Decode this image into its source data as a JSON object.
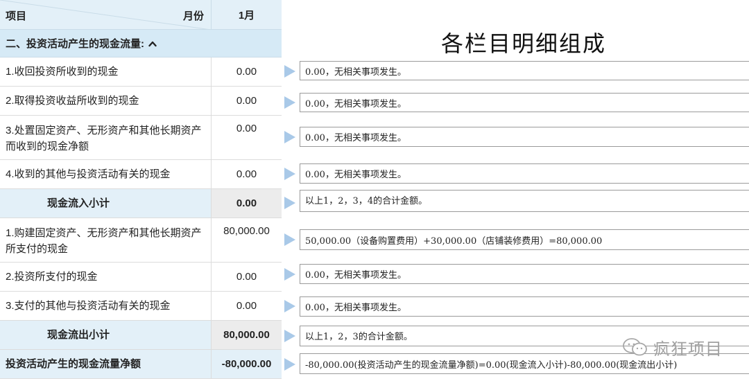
{
  "header": {
    "item_label": "项目",
    "month_label": "月份",
    "col_month": "1月"
  },
  "section": {
    "title": "二、投资活动产生的现金流量:"
  },
  "rows": [
    {
      "label": "1.收回投资所收到的现金",
      "value": "0.00"
    },
    {
      "label": "2.取得投资收益所收到的现金",
      "value": "0.00"
    },
    {
      "label": "3.处置固定资产、无形资产和其他长期资产而收到的现金净额",
      "value": "0.00"
    },
    {
      "label": "4.收到的其他与投资活动有关的现金",
      "value": "0.00"
    },
    {
      "label": "现金流入小计",
      "value": "0.00"
    },
    {
      "label": "1.购建固定资产、无形资产和其他长期资产所支付的现金",
      "value": "80,000.00"
    },
    {
      "label": "2.投资所支付的现金",
      "value": "0.00"
    },
    {
      "label": "3.支付的其他与投资活动有关的现金",
      "value": "0.00"
    },
    {
      "label": "现金流出小计",
      "value": "80,000.00"
    },
    {
      "label": "投资活动产生的现金流量净额",
      "value": "-80,000.00"
    }
  ],
  "detail_title": "各栏目明细组成",
  "details": [
    "0.00，无相关事项发生。",
    "0.00，无相关事项发生。",
    "0.00，无相关事项发生。",
    "0.00，无相关事项发生。",
    "以上1，2，3，4的合计金额。",
    "50,000.00（设备购置费用）+30,000.00（店铺装修费用）=80,000.00",
    "0.00，无相关事项发生。",
    "0.00，无相关事项发生。",
    "以上1，2，3的合计金额。",
    "-80,000.00(投资活动产生的现金流量净额)=0.00(现金流入小计)-80,000.00(现金流出小计)"
  ],
  "watermark": {
    "text": "疯狂项目",
    "icon": "wechat-icon"
  },
  "colors": {
    "header_bg": "#e3f0f8",
    "section_bg": "#d6eaf6",
    "arrow": "#a9c9e8",
    "subtotal_val_bg": "#ececec"
  }
}
